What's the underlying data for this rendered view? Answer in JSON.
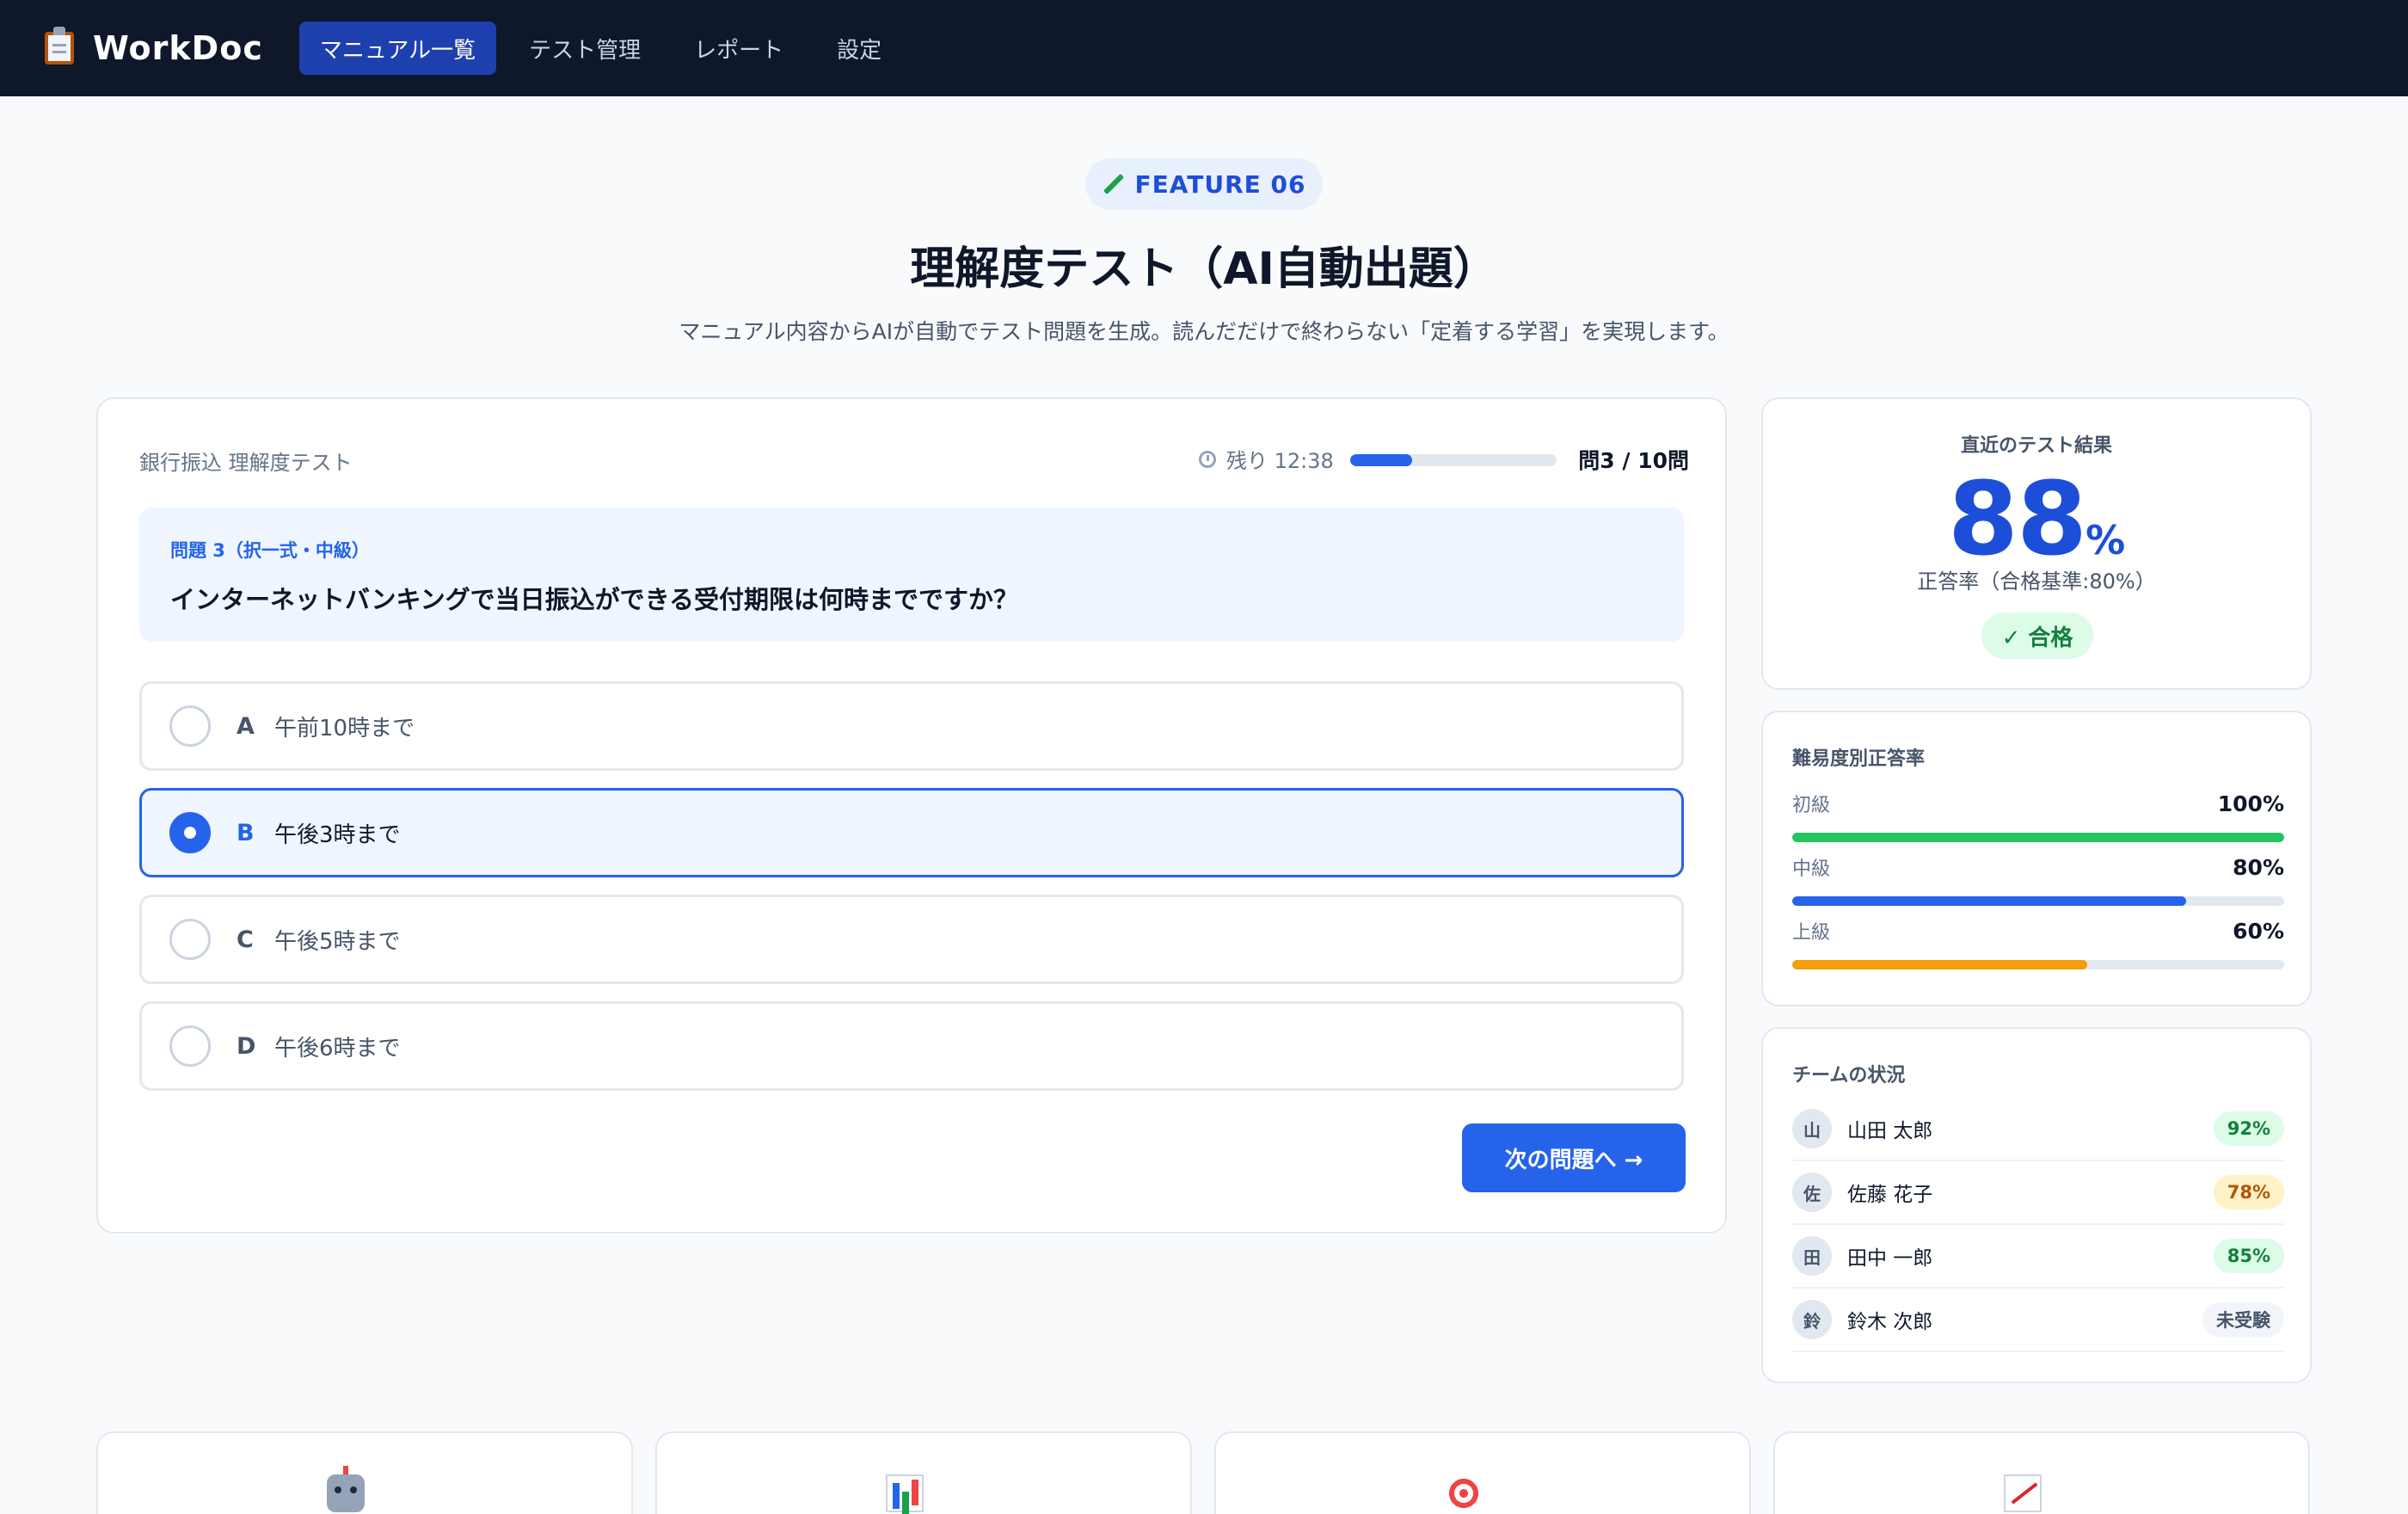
{
  "nav": {
    "brand": "WorkDoc",
    "brand_icon": "clipboard-icon",
    "items": [
      {
        "label": "マニュアル一覧",
        "active": true
      },
      {
        "label": "テスト管理",
        "active": false
      },
      {
        "label": "レポート",
        "active": false
      },
      {
        "label": "設定",
        "active": false
      }
    ]
  },
  "hero": {
    "badge": "FEATURE 06",
    "badge_icon": "pencil-icon",
    "title": "理解度テスト（AI自動出題）",
    "subtitle": "マニュアル内容からAIが自動でテスト問題を生成。読んだだけで終わらない「定着する学習」を実現します。"
  },
  "quiz": {
    "test_name": "銀行振込 理解度テスト",
    "timer": "残り 12:38",
    "progress": 0.3,
    "question_count": "問3 / 10問",
    "question": {
      "label": "問題 3（択一式・中級）",
      "text": "インターネットバンキングで当日振込ができる受付期限は何時までですか？"
    },
    "options": [
      {
        "letter": "A",
        "text": "午前10時まで",
        "selected": false
      },
      {
        "letter": "B",
        "text": "午後3時まで",
        "selected": true
      },
      {
        "letter": "C",
        "text": "午後5時まで",
        "selected": false
      },
      {
        "letter": "D",
        "text": "午後6時まで",
        "selected": false
      }
    ],
    "next_label": "次の問題へ →"
  },
  "result": {
    "heading": "直近のテスト結果",
    "score": "88",
    "unit": "%",
    "note": "正答率（合格基準:80%）",
    "status": "✓ 合格"
  },
  "difficulty": {
    "heading": "難易度別正答率",
    "rows": [
      {
        "label": "初級",
        "value": "100%",
        "fraction": 1.0,
        "color": "#22c55e"
      },
      {
        "label": "中級",
        "value": "80%",
        "fraction": 0.8,
        "color": "#2563eb"
      },
      {
        "label": "上級",
        "value": "60%",
        "fraction": 0.6,
        "color": "#f59e0b"
      }
    ]
  },
  "team": {
    "heading": "チームの状況",
    "members": [
      {
        "initial": "山",
        "name": "山田 太郎",
        "score": "92%",
        "bg": "#dcfce7",
        "fg": "#15803d"
      },
      {
        "initial": "佐",
        "name": "佐藤 花子",
        "score": "78%",
        "bg": "#fef3c7",
        "fg": "#b45309"
      },
      {
        "initial": "田",
        "name": "田中 一郎",
        "score": "85%",
        "bg": "#dcfce7",
        "fg": "#15803d"
      },
      {
        "initial": "鈴",
        "name": "鈴木 次郎",
        "score": "未受験",
        "bg": "#f1f5f9",
        "fg": "#475569"
      }
    ]
  },
  "features": [
    {
      "icon": "robot-icon"
    },
    {
      "icon": "bar-chart-icon"
    },
    {
      "icon": "target-icon"
    },
    {
      "icon": "line-chart-icon"
    }
  ]
}
